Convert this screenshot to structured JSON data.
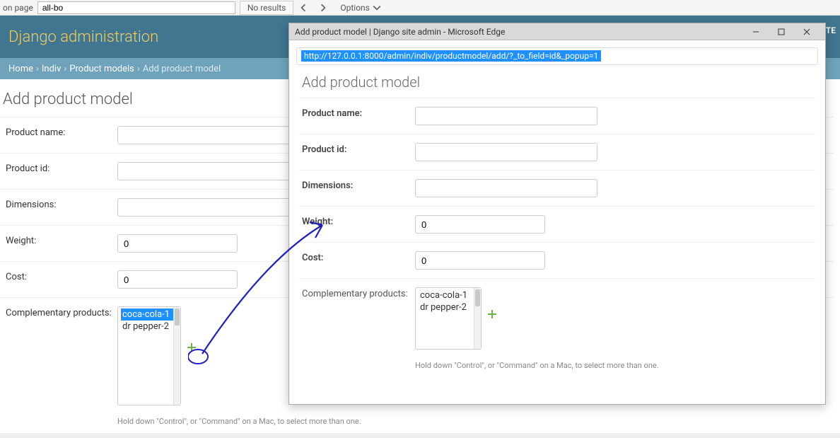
{
  "topbar": {
    "page_label": "on page",
    "search_value": "all-bo",
    "no_results": "No results",
    "options": "Options"
  },
  "header": {
    "title": "Django administration",
    "view_site": "SITE"
  },
  "breadcrumb": {
    "home": "Home",
    "indiv": "Indiv",
    "product_models": "Product models",
    "current": "Add product model"
  },
  "main": {
    "page_title": "Add product model",
    "labels": {
      "product_name": "Product name:",
      "product_id": "Product id:",
      "dimensions": "Dimensions:",
      "weight": "Weight:",
      "cost": "Cost:",
      "complementary": "Complementary products:"
    },
    "values": {
      "weight": "0",
      "cost": "0",
      "options": [
        "coca-cola-1",
        "dr pepper-2"
      ],
      "selected": "coca-cola-1"
    },
    "help": "Hold down \"Control\", or \"Command\" on a Mac, to select more than one."
  },
  "popup": {
    "title": "Add product model | Django site admin - Microsoft Edge",
    "url": "http://127.0.0.1:8000/admin/indiv/productmodel/add/?_to_field=id&_popup=1",
    "page_title": "Add product model",
    "labels": {
      "product_name": "Product name:",
      "product_id": "Product id:",
      "dimensions": "Dimensions:",
      "weight": "Weight:",
      "cost": "Cost:",
      "complementary": "Complementary products:"
    },
    "values": {
      "weight": "0",
      "cost": "0",
      "options": [
        "coca-cola-1",
        "dr pepper-2"
      ]
    },
    "help": "Hold down \"Control\", or \"Command\" on a Mac, to select more than one."
  }
}
